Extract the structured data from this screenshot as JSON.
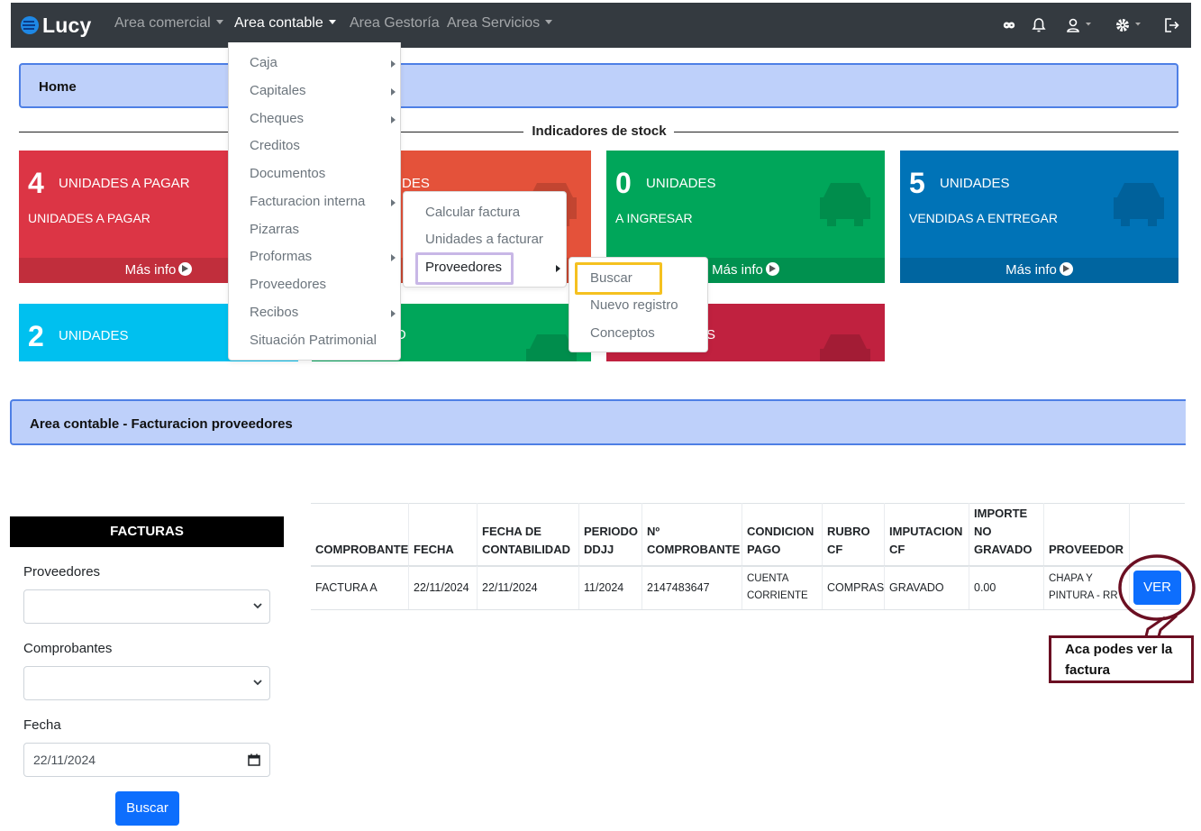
{
  "nav": {
    "brand": "Lucy",
    "items": [
      {
        "label": "Area comercial",
        "caret": true
      },
      {
        "label": "Area contable",
        "caret": true
      },
      {
        "label": "Area Gestoría",
        "caret": false
      },
      {
        "label": "Area Servicios",
        "caret": true
      }
    ],
    "icons": [
      "infinity-icon",
      "bell-icon",
      "user-icon",
      "gear-icon",
      "logout-icon"
    ]
  },
  "home": {
    "label": "Home"
  },
  "stock": {
    "title": "Indicadores de stock"
  },
  "boxes": [
    {
      "num": "4",
      "title": "UNIDADES A PAGAR",
      "sub": "UNIDADES A PAGAR",
      "footer": "Más info",
      "color": "#dc3545"
    },
    {
      "num": "",
      "title": "DES",
      "sub": "",
      "footer": "",
      "color": "#e4523a"
    },
    {
      "num": "0",
      "title": "UNIDADES",
      "sub": "A INGRESAR",
      "footer": "Más info",
      "color": "#00a65a"
    },
    {
      "num": "5",
      "title": "UNIDADES",
      "sub": "VENDIDAS A ENTREGAR",
      "footer": "Más info",
      "color": "#0073b7"
    },
    {
      "num": "2",
      "title": "UNIDADES",
      "sub": "",
      "footer": "",
      "color": "#00c0ef"
    },
    {
      "num": "",
      "title": "O",
      "sub": "",
      "footer": "",
      "color": "#00a65a"
    },
    {
      "num": "",
      "title": "S",
      "sub": "",
      "footer": "",
      "color": "#c0213f"
    }
  ],
  "menu_contable": [
    {
      "label": "Caja",
      "sub": true
    },
    {
      "label": "Capitales",
      "sub": true
    },
    {
      "label": "Cheques",
      "sub": true
    },
    {
      "label": "Creditos",
      "sub": false
    },
    {
      "label": "Documentos",
      "sub": false
    },
    {
      "label": "Facturacion interna",
      "sub": true
    },
    {
      "label": "Pizarras",
      "sub": false
    },
    {
      "label": "Proformas",
      "sub": true
    },
    {
      "label": "Proveedores",
      "sub": false
    },
    {
      "label": "Recibos",
      "sub": true
    },
    {
      "label": "Situación Patrimonial",
      "sub": false
    }
  ],
  "menu_facturacion": [
    {
      "label": "Calcular factura"
    },
    {
      "label": "Unidades a facturar"
    },
    {
      "label": "Proveedores"
    }
  ],
  "menu_proveedores": [
    {
      "label": "Buscar"
    },
    {
      "label": "Nuevo registro"
    },
    {
      "label": "Conceptos"
    }
  ],
  "section": {
    "title": "Area contable - Facturacion proveedores"
  },
  "form": {
    "header": "FACTURAS",
    "proveedores_label": "Proveedores",
    "proveedores_value": "",
    "comprobantes_label": "Comprobantes",
    "comprobantes_value": "",
    "fecha_label": "Fecha",
    "fecha_value": "22/11/2024",
    "button": "Buscar"
  },
  "table": {
    "headers": [
      "COMPROBANTE",
      "FECHA",
      "FECHA DE CONTABILIDAD",
      "PERIODO DDJJ",
      "Nº COMPROBANTE",
      "CONDICION PAGO",
      "RUBRO CF",
      "IMPUTACION CF",
      "IMPORTE NO GRAVADO",
      "PROVEEDOR",
      ""
    ],
    "row": [
      "FACTURA A",
      "22/11/2024",
      "22/11/2024",
      "11/2024",
      "2147483647",
      "CUENTA CORRIENTE",
      "COMPRAS",
      "GRAVADO",
      "0.00",
      "CHAPA Y PINTURA - RR",
      ""
    ],
    "action": "VER"
  },
  "annotation": {
    "text": "Aca podes ver la factura"
  }
}
